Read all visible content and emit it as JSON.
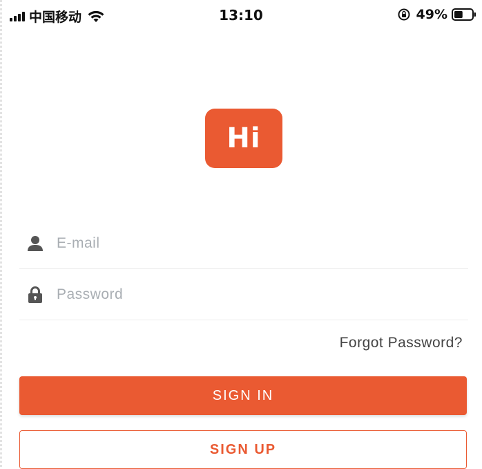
{
  "status_bar": {
    "carrier": "中国移动",
    "time": "13:10",
    "battery_percent": "49%",
    "battery_level": 0.49,
    "icons": [
      "signal-icon",
      "wifi-icon",
      "rotation-lock-icon",
      "battery-icon"
    ]
  },
  "logo": {
    "text": "Hi",
    "color": "#ea5a32"
  },
  "login_form": {
    "email": {
      "placeholder": "E-mail",
      "value": "",
      "icon": "user-icon"
    },
    "password": {
      "placeholder": "Password",
      "value": "",
      "icon": "lock-icon"
    },
    "forgot_label": "Forgot Password?",
    "signin_label": "SIGN IN",
    "signup_label": "SIGN UP"
  },
  "colors": {
    "accent": "#ea5a32",
    "placeholder": "#a9aeb3"
  }
}
